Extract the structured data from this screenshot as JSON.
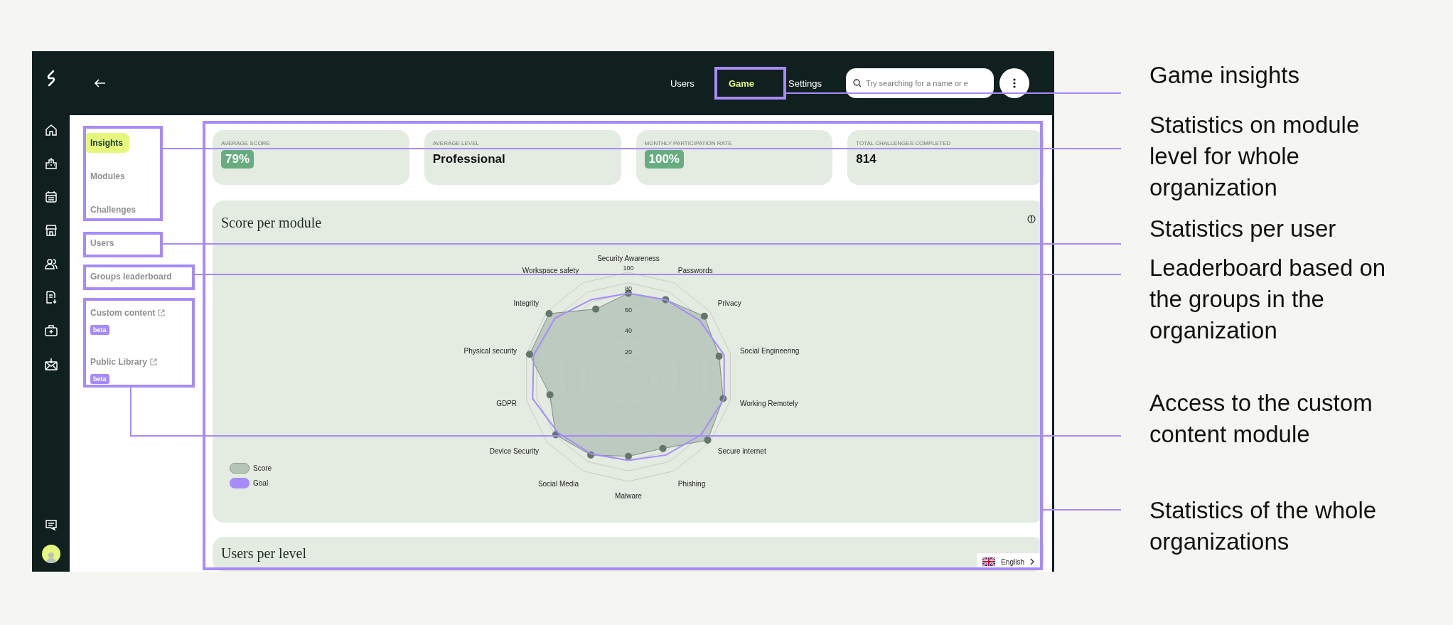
{
  "header": {
    "tabs": [
      {
        "label": "Users",
        "selected": false
      },
      {
        "label": "Game",
        "selected": true
      },
      {
        "label": "Settings",
        "selected": false
      }
    ],
    "search": {
      "placeholder": "Try searching for a name or e"
    }
  },
  "subnav": {
    "items": [
      {
        "label": "Insights",
        "selected": true
      },
      {
        "label": "Modules",
        "selected": false
      },
      {
        "label": "Challenges",
        "selected": false
      },
      {
        "label": "Users",
        "selected": false
      },
      {
        "label": "Groups leaderboard",
        "selected": false
      },
      {
        "label": "Custom content",
        "selected": false,
        "external": true,
        "badge": "beta"
      },
      {
        "label": "Public Library",
        "selected": false,
        "external": true,
        "badge": "beta"
      }
    ]
  },
  "stats": [
    {
      "label": "AVERAGE SCORE",
      "value": "79%",
      "kind": "badge"
    },
    {
      "label": "AVERAGE LEVEL",
      "value": "Professional",
      "kind": "plain"
    },
    {
      "label": "MONTHLY PARTICIPATION RATE",
      "value": "100%",
      "kind": "badge"
    },
    {
      "label": "TOTAL CHALLENGES COMPLETED",
      "value": "814",
      "kind": "plain"
    }
  ],
  "score_card": {
    "title": "Score per module",
    "chart_data": {
      "type": "radar",
      "categories": [
        "Security Awareness",
        "Passwords",
        "Privacy",
        "Social Engineering",
        "Working Remotely",
        "Secure internet",
        "Phishing",
        "Malware",
        "Social Media",
        "Device Security",
        "GDPR",
        "Physical security",
        "Integrity",
        "Workspace safety"
      ],
      "ylim": [
        0,
        100
      ],
      "yticks": [
        20,
        40,
        60,
        80,
        100
      ],
      "series": [
        {
          "name": "Score",
          "color": "#b6c4b8",
          "values": [
            80,
            82,
            93,
            89,
            93,
            97,
            76,
            76,
            83,
            89,
            77,
            97,
            97,
            72
          ]
        },
        {
          "name": "Goal",
          "color": "#a78bfa",
          "values": [
            80,
            82,
            87,
            94,
            94,
            89,
            83,
            80,
            82,
            86,
            94,
            93,
            90,
            82
          ]
        }
      ]
    }
  },
  "users_card": {
    "title": "Users per level"
  },
  "language": "English",
  "annotations": [
    "Game insights",
    "Statistics on module level for whole organization",
    "Statistics per user",
    "Leaderboard based on the groups in the organization",
    "Access to the custom content module",
    "Statistics of the whole organizations"
  ]
}
